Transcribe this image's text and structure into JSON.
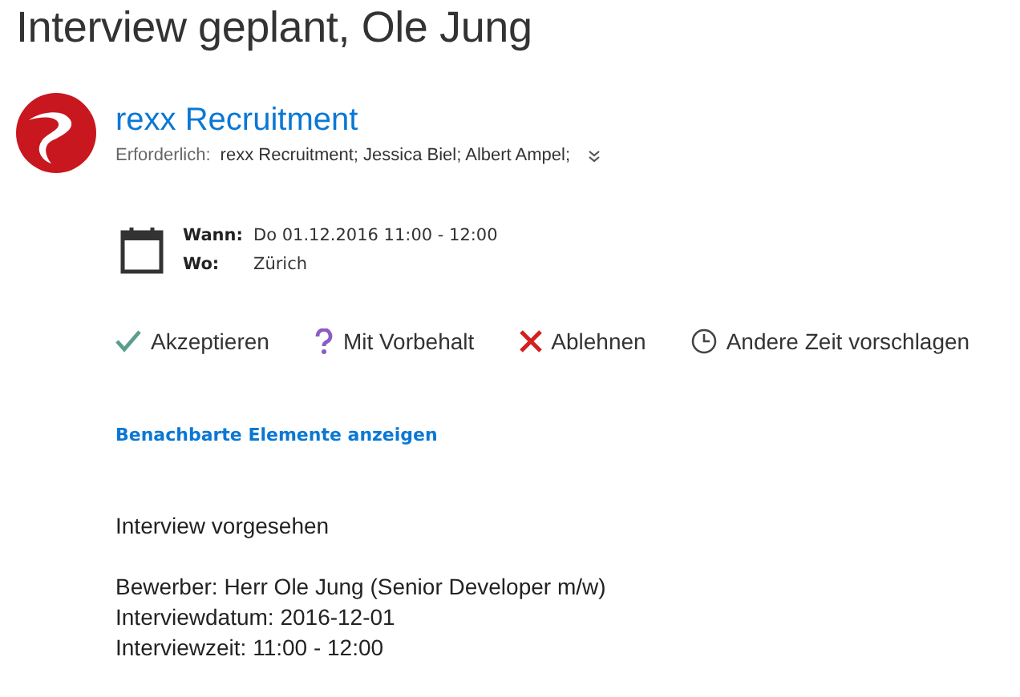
{
  "title": "Interview geplant, Ole Jung",
  "sender": {
    "name": "rexx Recruitment",
    "required_label": "Erforderlich:",
    "attendees": "rexx Recruitment; Jessica Biel; Albert Ampel;"
  },
  "details": [
    {
      "label": "Wann:",
      "value": "Do 01.12.2016 11:00 - 12:00"
    },
    {
      "label": "Wo:",
      "value": "Zürich"
    }
  ],
  "actions": [
    {
      "kind": "accept",
      "label": "Akzeptieren"
    },
    {
      "kind": "tentative",
      "label": "Mit Vorbehalt"
    },
    {
      "kind": "decline",
      "label": "Ablehnen"
    },
    {
      "kind": "propose",
      "label": "Andere Zeit vorschlagen"
    }
  ],
  "link": "Benachbarte Elemente anzeigen",
  "body": {
    "heading": "Interview vorgesehen",
    "lines": [
      "Bewerber: Herr Ole Jung (Senior Developer m/w)",
      "Interviewdatum: 2016-12-01",
      "Interviewzeit: 11:00 - 12:00"
    ]
  }
}
